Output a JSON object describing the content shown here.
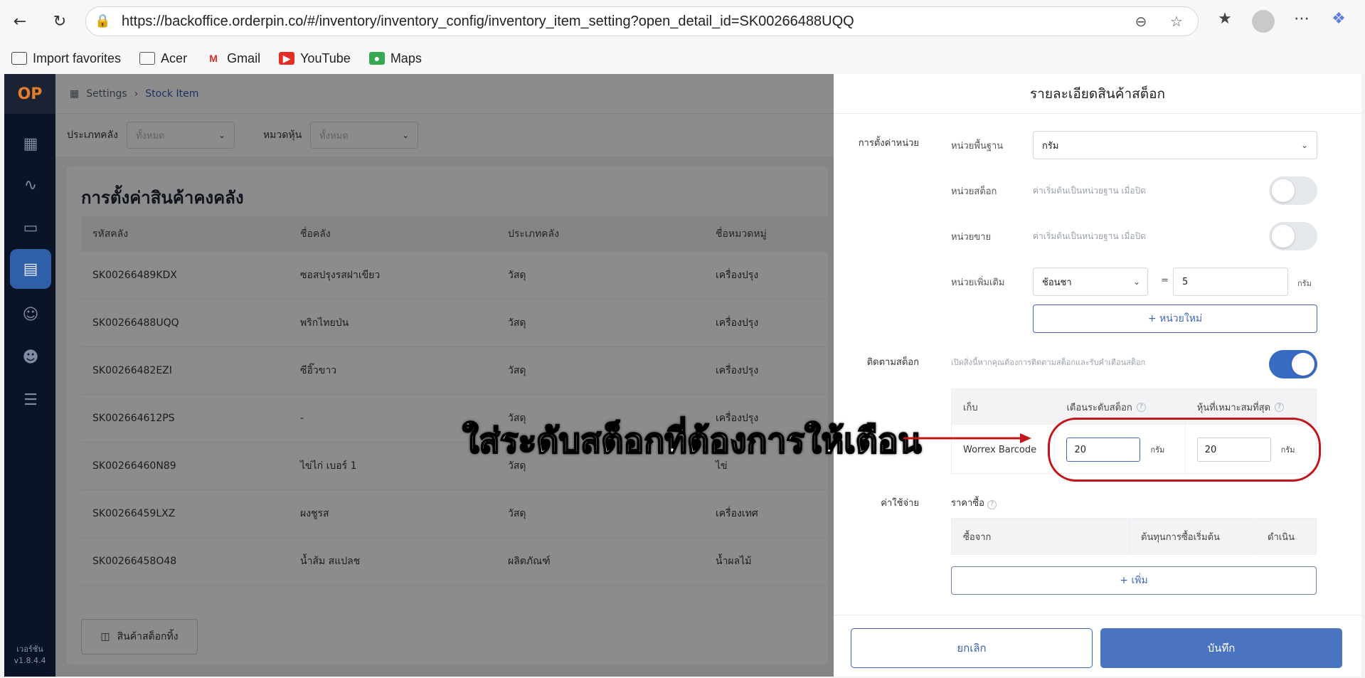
{
  "browser": {
    "url": "https://backoffice.orderpin.co/#/inventory/inventory_config/inventory_item_setting?open_detail_id=SK00266488UQQ",
    "bookmarks": [
      "Import favorites",
      "Acer",
      "Gmail",
      "YouTube",
      "Maps"
    ]
  },
  "sidebar": {
    "logo": "OP",
    "version": "เวอร์ชัน\nv1.8.4.4",
    "icons": [
      "grid-icon",
      "activity-icon",
      "bag-icon",
      "inventory-icon",
      "users-icon",
      "user-settings-icon",
      "sliders-icon"
    ]
  },
  "breadcrumb": {
    "root": "Settings",
    "current": "Stock Item"
  },
  "filters": {
    "type_label": "ประเภทคลัง",
    "type_value": "ทั้งหมด",
    "category_label": "หมวดหุ้น",
    "category_value": "ทั้งหมด"
  },
  "page": {
    "title": "การตั้งค่าสินค้าคงคลัง",
    "all_stock_button": "สินค้าสต็อกทิ้ง",
    "columns": [
      "รหัสคลัง",
      "ชื่อคลัง",
      "ประเภทคลัง",
      "ชื่อหมวดหมู่"
    ],
    "rows": [
      [
        "SK00266489KDX",
        "ซอสปรุงรสฝาเขียว",
        "วัสดุ",
        "เครื่องปรุง"
      ],
      [
        "SK00266488UQQ",
        "พริกไทยป่น",
        "วัสดุ",
        "เครื่องปรุง"
      ],
      [
        "SK00266482EZI",
        "ซีอิ๊วขาว",
        "วัสดุ",
        "เครื่องปรุง"
      ],
      [
        "SK002664612PS",
        "-",
        "วัสดุ",
        "เครื่องปรุง"
      ],
      [
        "SK00266460N89",
        "ไข่ไก่ เบอร์ 1",
        "วัสดุ",
        "ไข่"
      ],
      [
        "SK00266459LXZ",
        "ผงชูรส",
        "วัสดุ",
        "เครื่องเทศ"
      ],
      [
        "SK00266458O48",
        "น้ำส้ม สแปลช",
        "ผลิตภัณฑ์",
        "น้ำผลไม้"
      ]
    ]
  },
  "drawer": {
    "title": "รายละเอียดสินค้าสต็อก",
    "unit_section": "การตั้งค่าหน่วย",
    "base_unit_label": "หน่วยพื้นฐาน",
    "base_unit_value": "กรัม",
    "stock_unit_label": "หน่วยสต็อก",
    "stock_unit_hint": "ค่าเริ่มต้นเป็นหน่วยฐาน เมื่อปิด",
    "sale_unit_label": "หน่วยขาย",
    "sale_unit_hint": "ค่าเริ่มต้นเป็นหน่วยฐาน เมื่อปิด",
    "extra_unit_label": "หน่วยเพิ่มเติม",
    "extra_unit_value": "ช้อนชา",
    "equals": "=",
    "extra_unit_qty": "5",
    "extra_unit_suffix": "กรัม",
    "new_unit_button": "+ หน่วยใหม่",
    "tracking_section": "ติดตามสต็อก",
    "tracking_hint": "เปิดสิ่งนี้หากคุณต้องการติดตามสต็อกและรับคำเตือนสต็อก",
    "tracking_table": {
      "col_store": "เก็บ",
      "col_alert": "เตือนระดับสต็อก",
      "col_optimal": "หุ้นที่เหมาะสมที่สุด",
      "store_name": "Worrex Barcode",
      "alert_value": "20",
      "alert_unit": "กรัม",
      "optimal_value": "20",
      "optimal_unit": "กรัม"
    },
    "cost_section": "ค่าใช้จ่าย",
    "purchase_price_label": "ราคาซื้อ",
    "purchase_table": {
      "col_from": "ซื้อจาก",
      "col_cost": "ต้นทุนการซื้อเริ่มต้น",
      "col_action": "ดำเนิน"
    },
    "add_button": "+ เพิ่ม",
    "cancel_button": "ยกเลิก",
    "save_button": "บันทึก"
  },
  "annotation": {
    "text": "ใส่ระดับสต็อกที่ต้องการให้เตือน",
    "color": "#c0161c"
  }
}
